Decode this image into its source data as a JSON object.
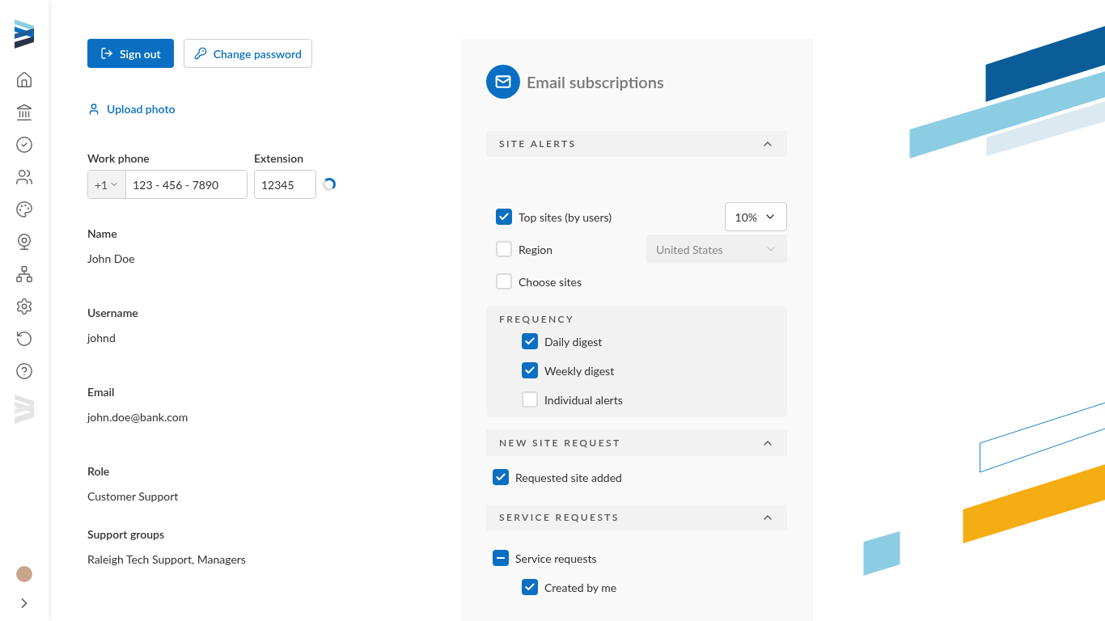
{
  "actions": {
    "sign_out": "Sign out",
    "change_password": "Change password",
    "upload_photo": "Upload photo"
  },
  "phone": {
    "label": "Work phone",
    "country_code": "+1",
    "value": "123 - 456 - 7890",
    "extension_label": "Extension",
    "extension": "12345",
    "loading": true
  },
  "profile": [
    {
      "label": "Name",
      "value": "John Doe"
    },
    {
      "label": "Username",
      "value": "johnd"
    },
    {
      "label": "Email",
      "value": "john.doe@bank.com"
    },
    {
      "label": "Role",
      "value": "Customer Support"
    },
    {
      "label": "Support groups",
      "value": "Raleigh Tech Support, Managers"
    }
  ],
  "subscriptions": {
    "title": "Email subscriptions",
    "site_alerts": {
      "title": "SITE ALERTS",
      "expanded": true,
      "options": [
        {
          "label": "Top sites (by users)",
          "checked": true,
          "select": {
            "value": "10%",
            "disabled": false
          }
        },
        {
          "label": "Region",
          "checked": false,
          "select": {
            "value": "United States",
            "disabled": true
          }
        },
        {
          "label": "Choose sites",
          "checked": false
        }
      ],
      "frequency": {
        "title": "FREQUENCY",
        "options": [
          {
            "label": "Daily digest",
            "checked": true
          },
          {
            "label": "Weekly digest",
            "checked": true
          },
          {
            "label": "Individual alerts",
            "checked": false
          }
        ]
      }
    },
    "new_site_request": {
      "title": "NEW SITE REQUEST",
      "expanded": true,
      "options": [
        {
          "label": "Requested site added",
          "checked": true
        }
      ]
    },
    "service_requests": {
      "title": "SERVICE REQUESTS",
      "expanded": true,
      "options": [
        {
          "label": "Service requests",
          "indeterminate": true,
          "children": [
            {
              "label": "Created by me",
              "checked": true
            }
          ]
        }
      ]
    }
  }
}
